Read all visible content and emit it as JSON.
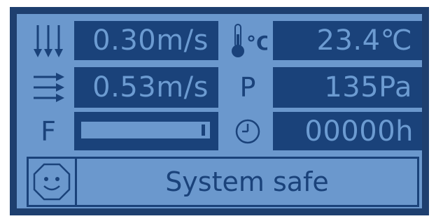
{
  "display": {
    "vertical_flow": {
      "icon": "vertical-airflow-arrows-icon",
      "value": "0.30m/s"
    },
    "temperature": {
      "icon": "thermometer-icon",
      "unit_label": "°C",
      "value": "23.4℃"
    },
    "horizontal_flow": {
      "icon": "horizontal-airflow-arrows-icon",
      "value": "0.53m/s"
    },
    "pressure": {
      "label": "P",
      "value": "135Pa"
    },
    "filter": {
      "label": "F",
      "level": 0.97
    },
    "runtime": {
      "icon": "clock-icon",
      "value": "00000h"
    },
    "status": {
      "icon": "smiley-face-icon",
      "text": "System safe"
    }
  },
  "colors": {
    "frame": "#1e3f6f",
    "panel": "#6b98cd",
    "cell": "#1a427a",
    "cell_text": "#6c9bd1"
  }
}
